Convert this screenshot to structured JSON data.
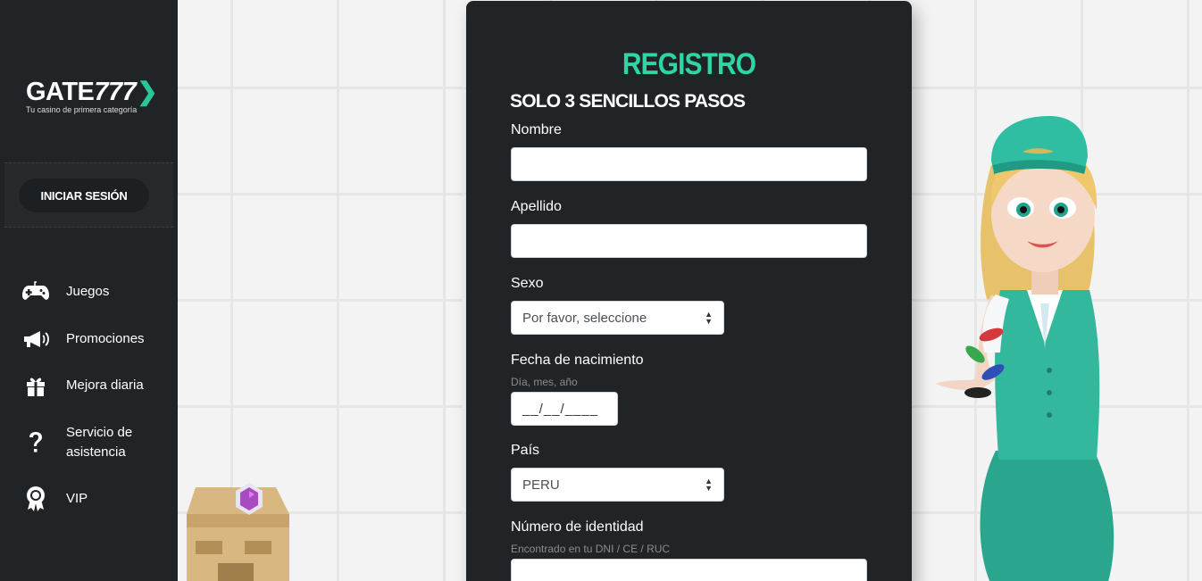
{
  "brand": {
    "logo_main": "GATE",
    "logo_num": "777",
    "tagline": "Tu casino de primera categoría"
  },
  "sidebar": {
    "login_label": "INICIAR SESIÓN",
    "items": [
      {
        "label": "Juegos",
        "icon": "gamepad-icon"
      },
      {
        "label": "Promociones",
        "icon": "megaphone-icon"
      },
      {
        "label": "Mejora diaria",
        "icon": "gift-icon"
      },
      {
        "label": "Servicio de asistencia",
        "icon": "question-icon"
      },
      {
        "label": "VIP",
        "icon": "award-icon"
      }
    ]
  },
  "form": {
    "title": "REGISTRO",
    "subtitle": "SOLO 3 SENCILLOS PASOS",
    "nombre_label": "Nombre",
    "nombre_value": "",
    "apellido_label": "Apellido",
    "apellido_value": "",
    "sexo_label": "Sexo",
    "sexo_value": "Por favor, seleccione",
    "fecha_label": "Fecha de nacimiento",
    "fecha_hint": "Día, mes, año",
    "fecha_value": "__/__/____",
    "pais_label": "País",
    "pais_value": "PERU",
    "identidad_label": "Número de identidad",
    "identidad_hint": "Encontrado en tu DNI / CE / RUC",
    "identidad_value": ""
  },
  "colors": {
    "accent": "#2fd6a4",
    "sidebar_bg": "#212427",
    "page_bg": "#f3f3f3"
  }
}
